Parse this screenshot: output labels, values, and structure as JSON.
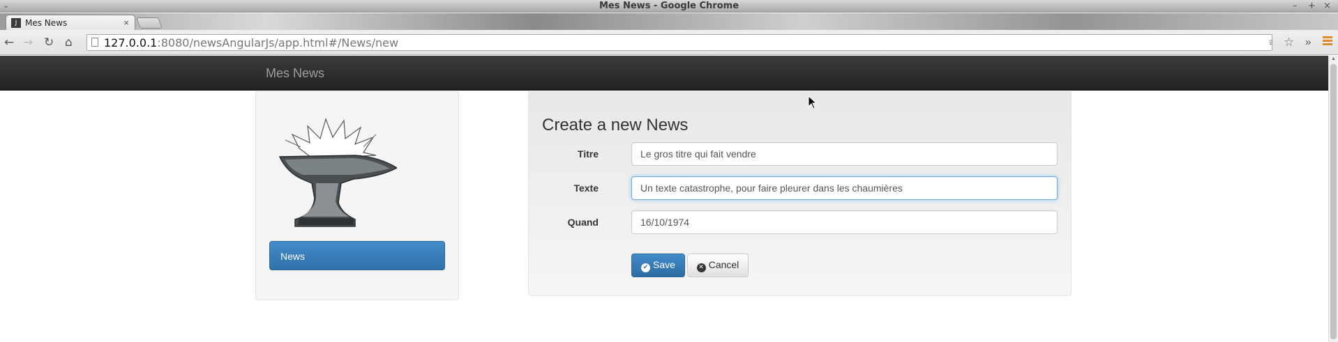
{
  "window": {
    "title": "Mes News - Google Chrome",
    "controls": [
      "–",
      "+",
      "×"
    ]
  },
  "tab": {
    "title": "Mes News",
    "favicon": "J",
    "close": "×"
  },
  "toolbar": {
    "back": "←",
    "forward": "→",
    "reload": "↻",
    "home": "⌂",
    "url_host": "127.0.0.1",
    "url_rest": ":8080/newsAngularJs/app.html#/News/new",
    "extension_icon": "♀",
    "star": "☆",
    "overflow": "»"
  },
  "navbar": {
    "brand": "Mes News"
  },
  "sidebar": {
    "logo": "anvil-logo",
    "items": [
      {
        "label": "News"
      }
    ]
  },
  "form": {
    "heading": "Create a new News",
    "fields": [
      {
        "label": "Titre",
        "value": "Le gros titre qui fait vendre"
      },
      {
        "label": "Texte",
        "value": "Un texte catastrophe, pour faire pleurer dans les chaumières"
      },
      {
        "label": "Quand",
        "value": "16/10/1974"
      }
    ],
    "save_label": "Save",
    "save_icon": "✔",
    "cancel_label": "Cancel",
    "cancel_icon": "✕"
  },
  "colors": {
    "primary": "#428bca",
    "navbar": "#222222",
    "focus": "#66afe9"
  }
}
